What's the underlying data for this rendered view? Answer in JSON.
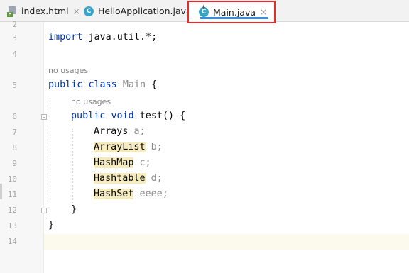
{
  "tabs": [
    {
      "label": "index.html",
      "close": "×",
      "icon": "html-file-icon"
    },
    {
      "label": "HelloApplication.java",
      "close": "×",
      "icon": "java-class-icon"
    },
    {
      "label": "Main.java",
      "close": "×",
      "icon": "java-class-icon",
      "modified_marker": "*",
      "active": true
    }
  ],
  "icon_glyphs": {
    "html": "H",
    "class": "C"
  },
  "line_numbers": [
    "2",
    "3",
    "4",
    "5",
    "6",
    "7",
    "8",
    "9",
    "10",
    "11",
    "12",
    "13",
    "14"
  ],
  "hints": {
    "class_usages": "no usages",
    "method_usages": "no usages"
  },
  "code": {
    "import_kw": "import",
    "import_rest": "java.util.*;",
    "public_kw": "public",
    "class_kw": "class",
    "class_name": "Main",
    "open_brace": "{",
    "method_public_kw": "public",
    "void_kw": "void",
    "method_sig": "test() {",
    "fields": [
      {
        "type": "Arrays",
        "name": "a;",
        "highlight": false
      },
      {
        "type": "ArrayList",
        "name": "b;",
        "highlight": true
      },
      {
        "type": "HashMap",
        "name": "c;",
        "highlight": true
      },
      {
        "type": "Hashtable",
        "name": "d;",
        "highlight": true
      },
      {
        "type": "HashSet",
        "name": "eeee;",
        "highlight": true
      }
    ],
    "method_close": "}",
    "class_close": "}"
  },
  "colors": {
    "accent_red": "#e52b2b",
    "tab_underline": "#3b8fe0",
    "keyword": "#0033b3",
    "highlight": "#f6ebbc"
  }
}
